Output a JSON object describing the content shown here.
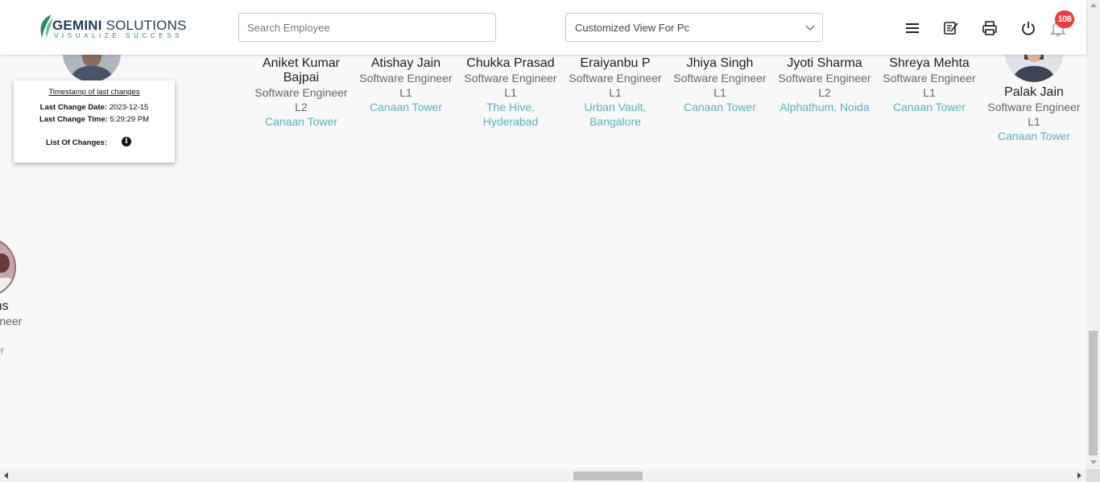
{
  "header": {
    "logo": {
      "brand_bold": "GEMINI",
      "brand_rest": " SOLUTIONS",
      "tagline": "VISUALIZE SUCCESS"
    },
    "search": {
      "placeholder": "Search Employee"
    },
    "view_select": {
      "value": "Customized View For Pc"
    },
    "icons": [
      "menu-icon",
      "notes-icon",
      "printer-icon",
      "power-icon",
      "bell-icon"
    ],
    "notification_count": "108"
  },
  "timestamp_card": {
    "title": "Timestamp of last changes",
    "date_label": "Last Change Date:",
    "date_value": "2023-12-15",
    "time_label": "Last Change Time:",
    "time_value": "5:29:29 PM",
    "changes_label": "List Of Changes:"
  },
  "employees": [
    {
      "name": "Aniket Kumar Bajpai",
      "role": "Software Engineer L2",
      "location": "Canaan Tower"
    },
    {
      "name": "Atishay Jain",
      "role": "Software Engineer L1",
      "location": "Canaan Tower"
    },
    {
      "name": "Chukka Prasad",
      "role": "Software Engineer L1",
      "location": "The Hive, Hyderabad"
    },
    {
      "name": "Eraiyanbu P",
      "role": "Software Engineer L1",
      "location": "Urban Vault, Bangalore"
    },
    {
      "name": "Jhiya Singh",
      "role": "Software Engineer L1",
      "location": "Canaan Tower"
    },
    {
      "name": "Jyoti Sharma",
      "role": "Software Engineer L2",
      "location": "Alphathum, Noida"
    },
    {
      "name": "Shreya Mehta",
      "role": "Software Engineer L1",
      "location": "Canaan Tower"
    },
    {
      "name": "Palak Jain",
      "role": "Software Engineer L1",
      "location": "Canaan Tower"
    }
  ],
  "partial_employee": {
    "name": "Hans",
    "role": "ngineer",
    "location": "ower"
  },
  "colors": {
    "location": "#56b3bf",
    "badge": "#ef3b3b",
    "brand": "#1f3b5c"
  }
}
